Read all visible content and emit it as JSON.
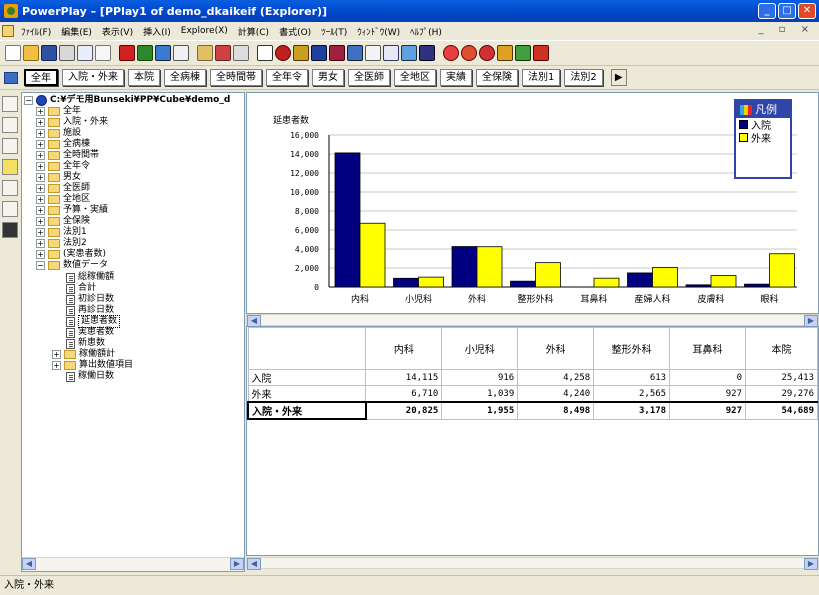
{
  "window": {
    "title": "PowerPlay – [PPlay1 of demo_dkaikeif (Explorer)]"
  },
  "menu": [
    "ﾌｧｲﾙ(F)",
    "編集(E)",
    "表示(V)",
    "挿入(I)",
    "Explore(X)",
    "計算(C)",
    "書式(O)",
    "ﾂｰﾙ(T)",
    "ｳｨﾝﾄﾞｳ(W)",
    "ﾍﾙﾌﾟ(H)"
  ],
  "dimension_line": [
    "全年",
    "入院・外来",
    "本院",
    "全病棟",
    "全時間帯",
    "全年令",
    "男女",
    "全医師",
    "全地区",
    "実績",
    "全保険",
    "法別1",
    "法別2"
  ],
  "tree": {
    "root": "C:¥デモ用Bunseki¥PP¥Cube¥demo_d",
    "folders": [
      "全年",
      "入院・外来",
      "施設",
      "全病棟",
      "全時間帯",
      "全年令",
      "男女",
      "全医師",
      "全地区",
      "予算・実績",
      "全保険",
      "法別1",
      "法別2",
      "(実患者数)"
    ],
    "measures_folder": "数値データ",
    "measures": [
      "総稼働額",
      "合計",
      "初診日数",
      "再診日数",
      "延患者数",
      "実患者数",
      "新患数"
    ],
    "selected_measure": "延患者数",
    "sub_folders": [
      "稼働額計",
      "算出数値項目"
    ],
    "last_item": "稼働日数"
  },
  "chart_data": {
    "type": "bar",
    "title": "",
    "ylabel": "延患者数",
    "xlabel": "",
    "ylim": [
      0,
      16000
    ],
    "yticks": [
      "0",
      "2,000",
      "4,000",
      "6,000",
      "8,000",
      "10,000",
      "12,000",
      "14,000",
      "16,000"
    ],
    "categories": [
      "内科",
      "小児科",
      "外科",
      "整形外科",
      "耳鼻科",
      "産婦人科",
      "皮膚科",
      "眼科"
    ],
    "series": [
      {
        "name": "入院",
        "color": "#000080",
        "values": [
          14115,
          916,
          4258,
          613,
          0,
          1480,
          230,
          300
        ]
      },
      {
        "name": "外来",
        "color": "#ffff00",
        "values": [
          6710,
          1039,
          4240,
          2565,
          927,
          2050,
          1200,
          3500
        ]
      }
    ],
    "legend_title": "凡例",
    "legend_position": "top-right",
    "grid": true
  },
  "crosstab": {
    "columns": [
      "内科",
      "小児科",
      "外科",
      "整形外科",
      "耳鼻科",
      "本院"
    ],
    "rows": [
      {
        "label": "入院",
        "values": [
          "14,115",
          "916",
          "4,258",
          "613",
          "0",
          "25,413"
        ]
      },
      {
        "label": "外来",
        "values": [
          "6,710",
          "1,039",
          "4,240",
          "2,565",
          "927",
          "29,276"
        ]
      },
      {
        "label": "入院・外来",
        "values": [
          "20,825",
          "1,955",
          "8,498",
          "3,178",
          "927",
          "54,689"
        ],
        "total": true
      }
    ]
  },
  "status": {
    "text": "入院・外来"
  }
}
